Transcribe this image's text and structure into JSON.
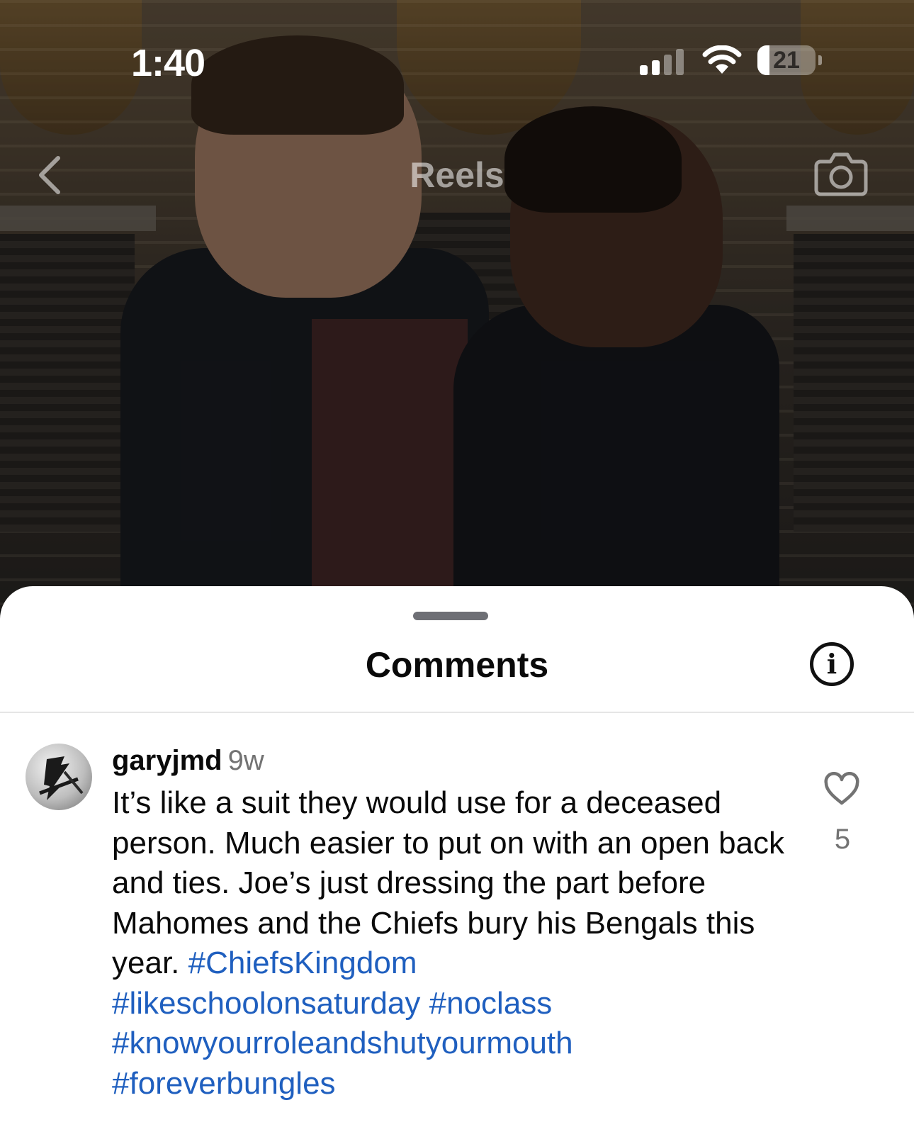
{
  "status_bar": {
    "time": "1:40",
    "battery_level": "21",
    "battery_fraction": 0.21,
    "signal_bars_active": 2,
    "signal_bars_total": 4
  },
  "header": {
    "title": "Reels",
    "back_icon": "chevron-left-icon",
    "camera_icon": "camera-icon"
  },
  "comments_sheet": {
    "title": "Comments",
    "info_icon": "info-icon",
    "comments": [
      {
        "username": "garyjmd",
        "time": "9w",
        "text": "It’s like a suit they would use for a deceased person. Much easier to put on with an open back and ties. Joe’s just dressing the part before Mahomes and the Chiefs bury his Bengals this year.",
        "hashtags": [
          "#ChiefsKingdom",
          "#likeschoolonsaturday",
          "#noclass",
          "#knowyourroleandshutyourmouth",
          "#foreverbungles"
        ],
        "like_count": "5",
        "like_icon": "heart-outline-icon"
      }
    ]
  },
  "colors": {
    "hashtag": "#1f5fbf",
    "secondary_text": "#737373",
    "sheet_background": "#ffffff"
  }
}
